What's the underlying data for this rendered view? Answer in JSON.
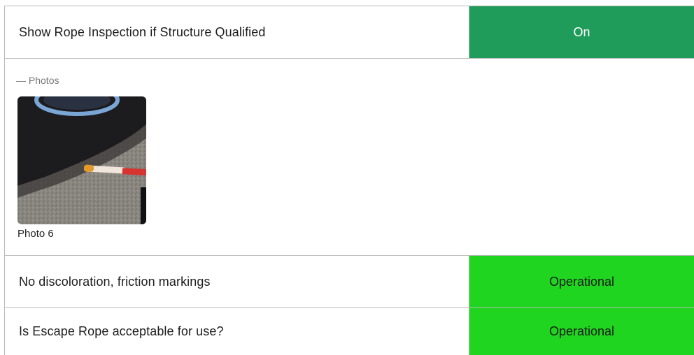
{
  "rows": [
    {
      "label": "Show Rope Inspection if Structure Qualified",
      "value": "On",
      "value_color": "#1f9b5a"
    },
    {
      "label": "No discoloration, friction markings",
      "value": "Operational",
      "value_color": "#1fd51f"
    },
    {
      "label": "Is Escape Rope acceptable for use?",
      "value": "Operational",
      "value_color": "#1fd51f"
    }
  ],
  "photos": {
    "header": "— Photos",
    "items": [
      {
        "caption": "Photo 6"
      }
    ]
  }
}
